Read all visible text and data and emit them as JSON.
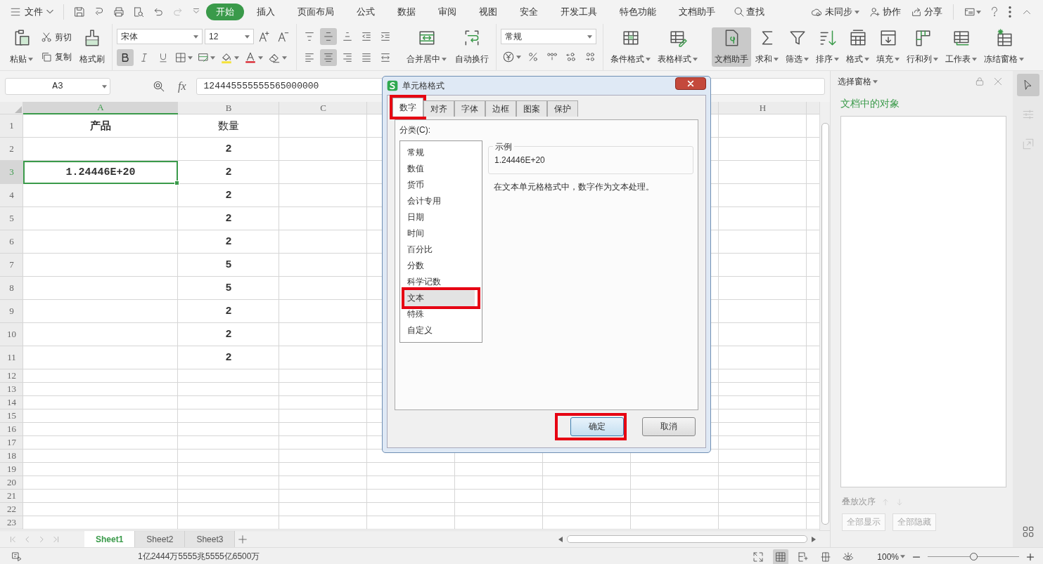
{
  "menu_bar": {
    "file_menu": "文件",
    "tabs": [
      {
        "label": "开始",
        "selected": true
      },
      {
        "label": "插入",
        "selected": false
      },
      {
        "label": "页面布局",
        "selected": false
      },
      {
        "label": "公式",
        "selected": false
      },
      {
        "label": "数据",
        "selected": false
      },
      {
        "label": "审阅",
        "selected": false
      },
      {
        "label": "视图",
        "selected": false
      },
      {
        "label": "安全",
        "selected": false
      },
      {
        "label": "开发工具",
        "selected": false
      },
      {
        "label": "特色功能",
        "selected": false
      },
      {
        "label": "文档助手",
        "selected": false
      }
    ],
    "search": "查找",
    "right_items": [
      {
        "kind": "sync",
        "label": "未同步"
      },
      {
        "kind": "collab",
        "label": "协作"
      },
      {
        "kind": "share",
        "label": "分享"
      }
    ]
  },
  "ribbon": {
    "clipboard": {
      "paste": "粘贴",
      "cut": "剪切",
      "copy": "复制",
      "format_painter": "格式刷"
    },
    "font": {
      "name": "宋体",
      "size": "12",
      "bold": true,
      "italic": false,
      "underline": false
    },
    "alignment": {
      "buttons": [
        {
          "kind": "top",
          "selected": false
        },
        {
          "kind": "middle",
          "selected": true
        },
        {
          "kind": "bottom",
          "selected": false
        },
        {
          "kind": "outdent",
          "selected": false
        },
        {
          "kind": "indent",
          "selected": false
        },
        {
          "kind": "left",
          "selected": false
        },
        {
          "kind": "center",
          "selected": true
        },
        {
          "kind": "right",
          "selected": false
        },
        {
          "kind": "justify",
          "selected": false
        },
        {
          "kind": "distributed",
          "selected": false
        }
      ],
      "merge": "合并居中",
      "wrap": "自动换行"
    },
    "number": {
      "format": "常规"
    },
    "tools": [
      {
        "kind": "conditional-format",
        "label": "条件格式",
        "dropdown": true,
        "selected": false
      },
      {
        "kind": "table-style",
        "label": "表格样式",
        "dropdown": true,
        "selected": false
      },
      {
        "kind": "assistant",
        "label": "文档助手",
        "dropdown": false,
        "selected": true
      },
      {
        "kind": "sum",
        "label": "求和",
        "dropdown": true,
        "selected": false
      },
      {
        "kind": "filter",
        "label": "筛选",
        "dropdown": true,
        "selected": false
      },
      {
        "kind": "sort",
        "label": "排序",
        "dropdown": true,
        "selected": false
      },
      {
        "kind": "format",
        "label": "格式",
        "dropdown": true,
        "selected": false
      },
      {
        "kind": "fill",
        "label": "填充",
        "dropdown": true,
        "selected": false
      },
      {
        "kind": "row-col",
        "label": "行和列",
        "dropdown": true,
        "selected": false
      },
      {
        "kind": "worksheet",
        "label": "工作表",
        "dropdown": true,
        "selected": false
      },
      {
        "kind": "freeze",
        "label": "冻结窗格",
        "dropdown": true,
        "selected": false
      }
    ]
  },
  "formula_bar": {
    "name_box": "A3",
    "function_label": "fx",
    "value": "124445555555565000000"
  },
  "sheet": {
    "columns": [
      {
        "label": "A",
        "selected": true
      },
      {
        "label": "B",
        "selected": false
      },
      {
        "label": "C",
        "selected": false
      },
      {
        "label": "H",
        "selected": false
      }
    ],
    "rows": [
      {
        "number": "1",
        "selected": false,
        "cells": {
          "A": {
            "text": "产品",
            "bold": true
          },
          "B": {
            "text": "数量",
            "bold": false
          }
        }
      },
      {
        "number": "2",
        "selected": false,
        "cells": {
          "B": {
            "text": "2",
            "bold": true
          }
        }
      },
      {
        "number": "3",
        "selected": true,
        "cells": {
          "A": {
            "text": "1.24446E+20",
            "bold": true,
            "selected": true
          },
          "B": {
            "text": "2",
            "bold": true
          }
        }
      },
      {
        "number": "4",
        "selected": false,
        "cells": {
          "B": {
            "text": "2",
            "bold": true
          }
        }
      },
      {
        "number": "5",
        "selected": false,
        "cells": {
          "B": {
            "text": "2",
            "bold": true
          }
        }
      },
      {
        "number": "6",
        "selected": false,
        "cells": {
          "B": {
            "text": "2",
            "bold": true
          }
        }
      },
      {
        "number": "7",
        "selected": false,
        "cells": {
          "B": {
            "text": "5",
            "bold": true
          }
        }
      },
      {
        "number": "8",
        "selected": false,
        "cells": {
          "B": {
            "text": "5",
            "bold": true
          }
        }
      },
      {
        "number": "9",
        "selected": false,
        "cells": {
          "B": {
            "text": "2",
            "bold": true
          }
        }
      },
      {
        "number": "10",
        "selected": false,
        "cells": {
          "B": {
            "text": "2",
            "bold": true
          }
        }
      },
      {
        "number": "11",
        "selected": false,
        "cells": {
          "B": {
            "text": "2",
            "bold": true
          }
        }
      },
      {
        "number": "12",
        "selected": false
      },
      {
        "number": "13",
        "selected": false
      },
      {
        "number": "14",
        "selected": false
      },
      {
        "number": "15",
        "selected": false
      },
      {
        "number": "16",
        "selected": false
      },
      {
        "number": "17",
        "selected": false
      },
      {
        "number": "18",
        "selected": false
      },
      {
        "number": "19",
        "selected": false
      },
      {
        "number": "20",
        "selected": false
      },
      {
        "number": "21",
        "selected": false
      },
      {
        "number": "22",
        "selected": false
      },
      {
        "number": "23",
        "selected": false
      }
    ]
  },
  "sheet_tabs": [
    {
      "label": "Sheet1",
      "selected": true
    },
    {
      "label": "Sheet2",
      "selected": false
    },
    {
      "label": "Sheet3",
      "selected": false
    }
  ],
  "status_bar": {
    "text": "1亿2444万5555兆5555亿6500万",
    "view_buttons": [
      {
        "kind": "fullscreen",
        "selected": false
      },
      {
        "kind": "normal",
        "selected": true
      },
      {
        "kind": "page-break",
        "selected": false
      },
      {
        "kind": "layout",
        "selected": false
      },
      {
        "kind": "eye",
        "selected": false
      }
    ],
    "zoom": {
      "label": "100%",
      "level": 0.5
    }
  },
  "selection_pane": {
    "title": "选择窗格",
    "heading": "文档中的对象",
    "order_label": "叠放次序",
    "buttons": [
      {
        "label": "全部显示",
        "disabled": true
      },
      {
        "label": "全部隐藏",
        "disabled": true
      }
    ]
  },
  "side_strip": [
    {
      "kind": "pointer",
      "selected": true,
      "disabled": false
    },
    {
      "kind": "sliders",
      "selected": false,
      "disabled": true
    },
    {
      "kind": "export",
      "selected": false,
      "disabled": true
    }
  ],
  "dialog": {
    "title": "单元格格式",
    "tabs": [
      {
        "label": "数字",
        "selected": true,
        "highlighted": true
      },
      {
        "label": "对齐",
        "selected": false,
        "highlighted": false
      },
      {
        "label": "字体",
        "selected": false,
        "highlighted": false
      },
      {
        "label": "边框",
        "selected": false,
        "highlighted": false
      },
      {
        "label": "图案",
        "selected": false,
        "highlighted": false
      },
      {
        "label": "保护",
        "selected": false,
        "highlighted": false
      }
    ],
    "category_label": "分类(C):",
    "categories": [
      {
        "label": "常规",
        "selected": false,
        "highlighted": false
      },
      {
        "label": "数值",
        "selected": false,
        "highlighted": false
      },
      {
        "label": "货币",
        "selected": false,
        "highlighted": false
      },
      {
        "label": "会计专用",
        "selected": false,
        "highlighted": false
      },
      {
        "label": "日期",
        "selected": false,
        "highlighted": false
      },
      {
        "label": "时间",
        "selected": false,
        "highlighted": false
      },
      {
        "label": "百分比",
        "selected": false,
        "highlighted": false
      },
      {
        "label": "分数",
        "selected": false,
        "highlighted": false
      },
      {
        "label": "科学记数",
        "selected": false,
        "highlighted": false
      },
      {
        "label": "文本",
        "selected": true,
        "highlighted": true
      },
      {
        "label": "特殊",
        "selected": false,
        "highlighted": false
      },
      {
        "label": "自定义",
        "selected": false,
        "highlighted": false
      }
    ],
    "sample_label": "示例",
    "sample_value": "1.24446E+20",
    "description": "在文本单元格格式中，数字作为文本处理。",
    "buttons": [
      {
        "label": "确定",
        "kind": "default",
        "highlighted": true
      },
      {
        "label": "取消",
        "kind": "normal",
        "highlighted": false
      }
    ]
  }
}
